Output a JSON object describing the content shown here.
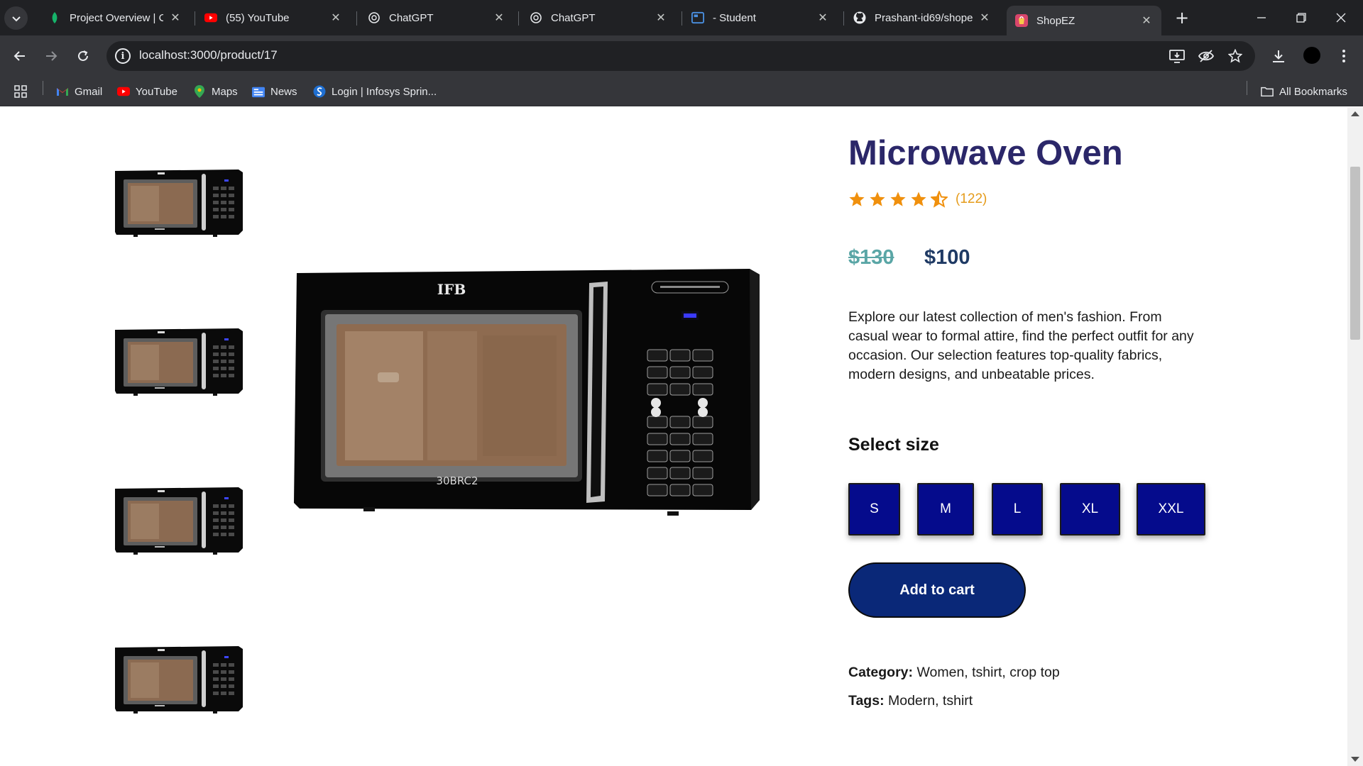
{
  "browser": {
    "tabs": [
      {
        "title": "Project Overview | Cl",
        "icon": "leaf-icon",
        "active": false
      },
      {
        "title": "(55) YouTube",
        "icon": "youtube-icon",
        "active": false
      },
      {
        "title": "ChatGPT",
        "icon": "openai-icon",
        "active": false
      },
      {
        "title": "ChatGPT",
        "icon": "openai-icon",
        "active": false
      },
      {
        "title": "- Student",
        "icon": "student-icon",
        "active": false
      },
      {
        "title": "Prashant-id69/shope",
        "icon": "github-icon",
        "active": false
      },
      {
        "title": "ShopEZ",
        "icon": "shopez-icon",
        "active": true
      }
    ],
    "url": "localhost:3000/product/17",
    "bookmarks": [
      {
        "label": "Gmail",
        "icon": "gmail-icon"
      },
      {
        "label": "YouTube",
        "icon": "youtube-icon"
      },
      {
        "label": "Maps",
        "icon": "maps-icon"
      },
      {
        "label": "News",
        "icon": "news-icon"
      },
      {
        "label": "Login | Infosys Sprin...",
        "icon": "infosys-icon"
      }
    ],
    "all_bookmarks_label": "All Bookmarks"
  },
  "product": {
    "title": "Microwave Oven",
    "rating": 4.5,
    "review_count": "(122)",
    "old_price": "$130",
    "price": "$100",
    "description": "Explore our latest collection of men's fashion. From casual wear to formal attire, find the perfect outfit for any occasion. Our selection features top-quality fabrics, modern designs, and unbeatable prices.",
    "size_heading": "Select size",
    "sizes": [
      "S",
      "M",
      "L",
      "XL",
      "XXL"
    ],
    "add_to_cart_label": "Add to cart",
    "category_label": "Category:",
    "category_value": "Women, tshirt, crop top",
    "tags_label": "Tags:",
    "tags_value": "Modern, tshirt",
    "image_brand": "IFB",
    "image_model": "30BRC2"
  },
  "colors": {
    "title": "#2b2769",
    "star": "#f0900d",
    "old_price": "#5aa6a6",
    "price": "#1f3a64",
    "size_button": "#050b8c",
    "cart_button": "#0a2878"
  }
}
